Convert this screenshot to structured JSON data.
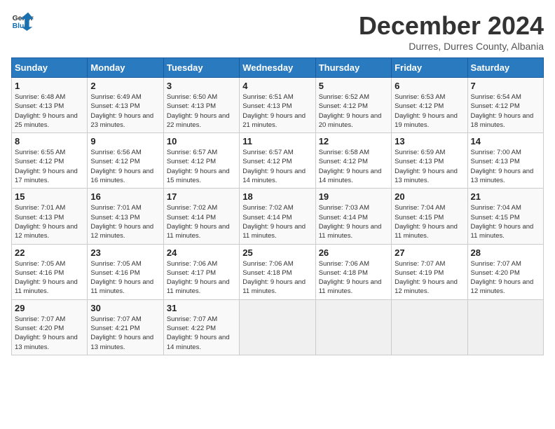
{
  "logo": {
    "text_general": "General",
    "text_blue": "Blue"
  },
  "header": {
    "month": "December 2024",
    "location": "Durres, Durres County, Albania"
  },
  "weekdays": [
    "Sunday",
    "Monday",
    "Tuesday",
    "Wednesday",
    "Thursday",
    "Friday",
    "Saturday"
  ],
  "weeks": [
    [
      {
        "day": "1",
        "sunrise": "6:48 AM",
        "sunset": "4:13 PM",
        "daylight": "9 hours and 25 minutes."
      },
      {
        "day": "2",
        "sunrise": "6:49 AM",
        "sunset": "4:13 PM",
        "daylight": "9 hours and 23 minutes."
      },
      {
        "day": "3",
        "sunrise": "6:50 AM",
        "sunset": "4:13 PM",
        "daylight": "9 hours and 22 minutes."
      },
      {
        "day": "4",
        "sunrise": "6:51 AM",
        "sunset": "4:13 PM",
        "daylight": "9 hours and 21 minutes."
      },
      {
        "day": "5",
        "sunrise": "6:52 AM",
        "sunset": "4:12 PM",
        "daylight": "9 hours and 20 minutes."
      },
      {
        "day": "6",
        "sunrise": "6:53 AM",
        "sunset": "4:12 PM",
        "daylight": "9 hours and 19 minutes."
      },
      {
        "day": "7",
        "sunrise": "6:54 AM",
        "sunset": "4:12 PM",
        "daylight": "9 hours and 18 minutes."
      }
    ],
    [
      {
        "day": "8",
        "sunrise": "6:55 AM",
        "sunset": "4:12 PM",
        "daylight": "9 hours and 17 minutes."
      },
      {
        "day": "9",
        "sunrise": "6:56 AM",
        "sunset": "4:12 PM",
        "daylight": "9 hours and 16 minutes."
      },
      {
        "day": "10",
        "sunrise": "6:57 AM",
        "sunset": "4:12 PM",
        "daylight": "9 hours and 15 minutes."
      },
      {
        "day": "11",
        "sunrise": "6:57 AM",
        "sunset": "4:12 PM",
        "daylight": "9 hours and 14 minutes."
      },
      {
        "day": "12",
        "sunrise": "6:58 AM",
        "sunset": "4:12 PM",
        "daylight": "9 hours and 14 minutes."
      },
      {
        "day": "13",
        "sunrise": "6:59 AM",
        "sunset": "4:13 PM",
        "daylight": "9 hours and 13 minutes."
      },
      {
        "day": "14",
        "sunrise": "7:00 AM",
        "sunset": "4:13 PM",
        "daylight": "9 hours and 13 minutes."
      }
    ],
    [
      {
        "day": "15",
        "sunrise": "7:01 AM",
        "sunset": "4:13 PM",
        "daylight": "9 hours and 12 minutes."
      },
      {
        "day": "16",
        "sunrise": "7:01 AM",
        "sunset": "4:13 PM",
        "daylight": "9 hours and 12 minutes."
      },
      {
        "day": "17",
        "sunrise": "7:02 AM",
        "sunset": "4:14 PM",
        "daylight": "9 hours and 11 minutes."
      },
      {
        "day": "18",
        "sunrise": "7:02 AM",
        "sunset": "4:14 PM",
        "daylight": "9 hours and 11 minutes."
      },
      {
        "day": "19",
        "sunrise": "7:03 AM",
        "sunset": "4:14 PM",
        "daylight": "9 hours and 11 minutes."
      },
      {
        "day": "20",
        "sunrise": "7:04 AM",
        "sunset": "4:15 PM",
        "daylight": "9 hours and 11 minutes."
      },
      {
        "day": "21",
        "sunrise": "7:04 AM",
        "sunset": "4:15 PM",
        "daylight": "9 hours and 11 minutes."
      }
    ],
    [
      {
        "day": "22",
        "sunrise": "7:05 AM",
        "sunset": "4:16 PM",
        "daylight": "9 hours and 11 minutes."
      },
      {
        "day": "23",
        "sunrise": "7:05 AM",
        "sunset": "4:16 PM",
        "daylight": "9 hours and 11 minutes."
      },
      {
        "day": "24",
        "sunrise": "7:06 AM",
        "sunset": "4:17 PM",
        "daylight": "9 hours and 11 minutes."
      },
      {
        "day": "25",
        "sunrise": "7:06 AM",
        "sunset": "4:18 PM",
        "daylight": "9 hours and 11 minutes."
      },
      {
        "day": "26",
        "sunrise": "7:06 AM",
        "sunset": "4:18 PM",
        "daylight": "9 hours and 11 minutes."
      },
      {
        "day": "27",
        "sunrise": "7:07 AM",
        "sunset": "4:19 PM",
        "daylight": "9 hours and 12 minutes."
      },
      {
        "day": "28",
        "sunrise": "7:07 AM",
        "sunset": "4:20 PM",
        "daylight": "9 hours and 12 minutes."
      }
    ],
    [
      {
        "day": "29",
        "sunrise": "7:07 AM",
        "sunset": "4:20 PM",
        "daylight": "9 hours and 13 minutes."
      },
      {
        "day": "30",
        "sunrise": "7:07 AM",
        "sunset": "4:21 PM",
        "daylight": "9 hours and 13 minutes."
      },
      {
        "day": "31",
        "sunrise": "7:07 AM",
        "sunset": "4:22 PM",
        "daylight": "9 hours and 14 minutes."
      },
      null,
      null,
      null,
      null
    ]
  ]
}
